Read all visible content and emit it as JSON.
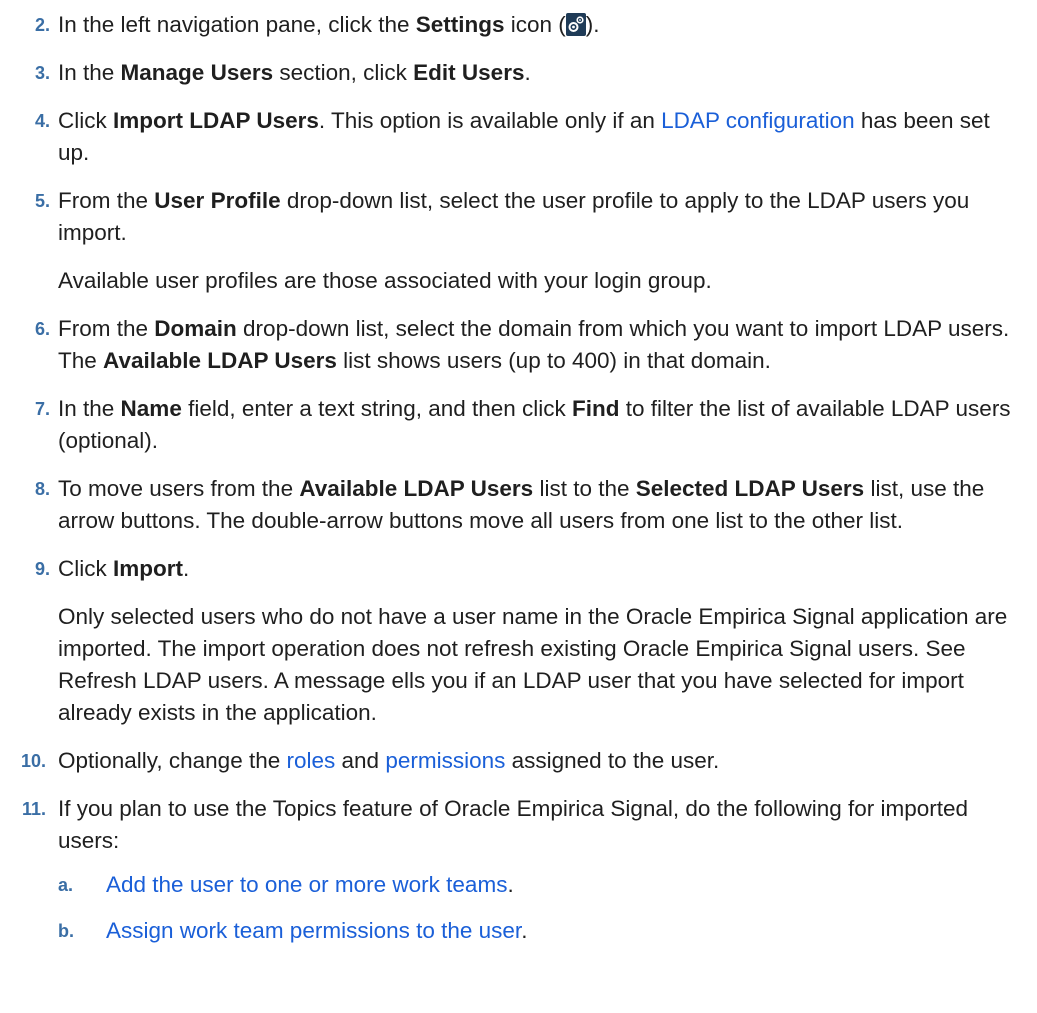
{
  "steps": [
    {
      "num": "2.",
      "pre": "In the left navigation pane, click the ",
      "b1": "Settings",
      "mid": " icon (",
      "post": ")."
    },
    {
      "num": "3.",
      "pre": "In the ",
      "b1": "Manage Users",
      "mid": " section, click ",
      "b2": "Edit Users",
      "post": "."
    },
    {
      "num": "4.",
      "pre": "Click ",
      "b1": "Import LDAP Users",
      "mid": ". This option is available only if an ",
      "link": "LDAP configuration",
      "post": " has been set up."
    },
    {
      "num": "5.",
      "pre": "From the ",
      "b1": "User Profile",
      "post": " drop-down list, select the user profile to apply to the LDAP users you import.",
      "extra": "Available user profiles are those associated with your login group."
    },
    {
      "num": "6.",
      "pre": "From the ",
      "b1": "Domain",
      "mid": " drop-down list, select the domain from which you want to import LDAP users. The ",
      "b2": "Available LDAP Users",
      "post": " list shows users (up to 400) in that domain."
    },
    {
      "num": "7.",
      "pre": "In the ",
      "b1": "Name",
      "mid": " field, enter a text string, and then click ",
      "b2": "Find",
      "post": " to filter the list of available LDAP users (optional)."
    },
    {
      "num": "8.",
      "pre": "To move users from the ",
      "b1": "Available LDAP Users",
      "mid": " list to the ",
      "b2": "Selected LDAP Users",
      "post": " list, use the arrow buttons. The double-arrow buttons move all users from one list to the other list."
    },
    {
      "num": "9.",
      "pre": "Click ",
      "b1": "Import",
      "post": ".",
      "extra": "Only selected users who do not have a user name in the Oracle Empirica Signal application are imported. The import operation does not refresh existing Oracle Empirica Signal users. See Refresh LDAP users. A message ells you if an LDAP user that you have selected for import already exists in the application."
    },
    {
      "num": "10.",
      "pre": "Optionally, change the ",
      "link1": "roles",
      "mid": " and ",
      "link2": "permissions",
      "post": " assigned to the user."
    },
    {
      "num": "11.",
      "text": "If you plan to use the Topics feature of Oracle Empirica Signal, do the following for imported users:"
    }
  ],
  "substeps": [
    {
      "lbl": "a.",
      "link": "Add the user to one or more work teams",
      "post": "."
    },
    {
      "lbl": "b.",
      "link": "Assign work team permissions to the user",
      "post": "."
    }
  ]
}
